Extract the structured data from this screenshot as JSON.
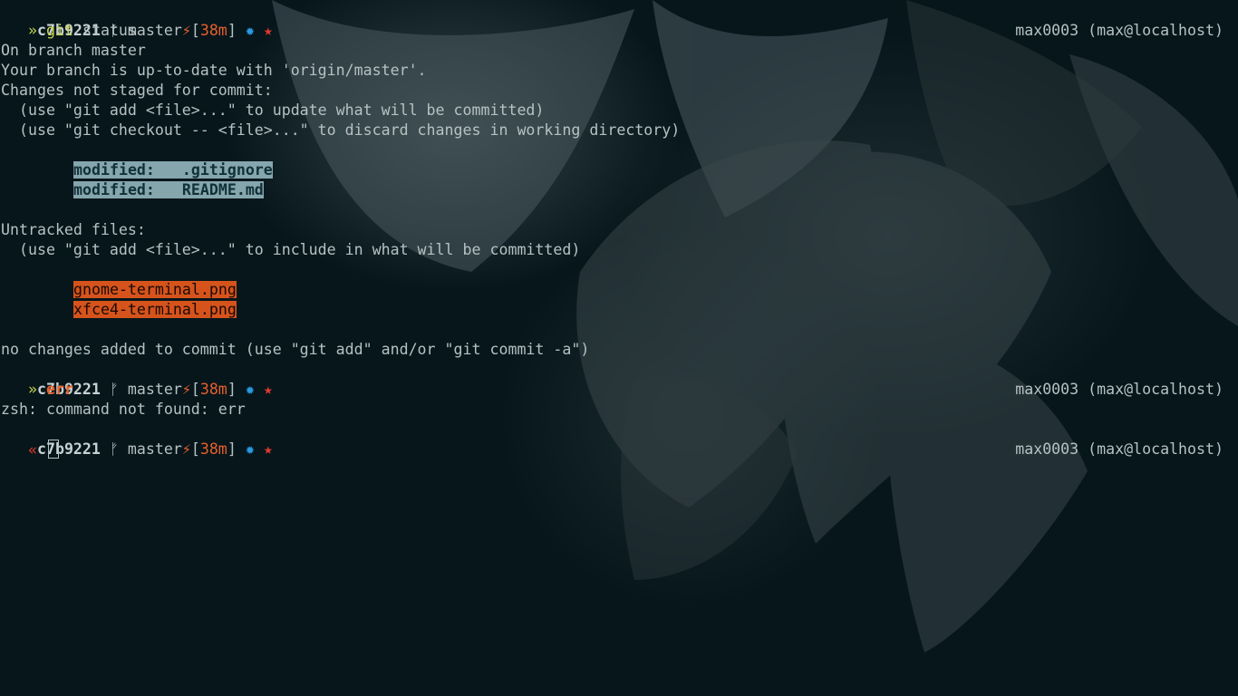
{
  "prompt": {
    "hash": "c7b9221",
    "branch_icon": "ᚠ",
    "branch": "master",
    "bolt": "⚡",
    "age_open": "[",
    "age": "38m",
    "age_close": "]",
    "sun": "✹",
    "star": "★",
    "right": "max0003 (max@localhost)",
    "arrow_in": "»",
    "arrow_err": "«"
  },
  "session": {
    "cmd1_part1": "git",
    "cmd1_part2": " status",
    "status_lines": [
      "On branch master",
      "Your branch is up-to-date with 'origin/master'.",
      "Changes not staged for commit:",
      "  (use \"git add <file>...\" to update what will be committed)",
      "  (use \"git checkout -- <file>...\" to discard changes in working directory)"
    ],
    "modified": [
      "modified:   .gitignore",
      "modified:   README.md"
    ],
    "untracked_header": "Untracked files:",
    "untracked_hint": "  (use \"git add <file>...\" to include in what will be committed)",
    "untracked": [
      "gnome-terminal.png",
      "xfce4-terminal.png"
    ],
    "no_changes": "no changes added to commit (use \"git add\" and/or \"git commit -a\")",
    "cmd2": "err",
    "error": "zsh: command not found: err"
  },
  "colors": {
    "background": "#061a20",
    "foreground": "#b6c1c3",
    "accent_green": "#c8d64a",
    "accent_orange": "#e8602c",
    "accent_red": "#e03a2f",
    "accent_blue": "#2b9ae0",
    "modified_bg": "#86a6ad",
    "untracked_bg": "#d6541c"
  },
  "icons": {
    "branch": "git-branch-icon",
    "bolt": "lightning-icon",
    "sun": "dirty-indicator-icon",
    "star": "star-icon",
    "cursor": "block-cursor-icon"
  }
}
